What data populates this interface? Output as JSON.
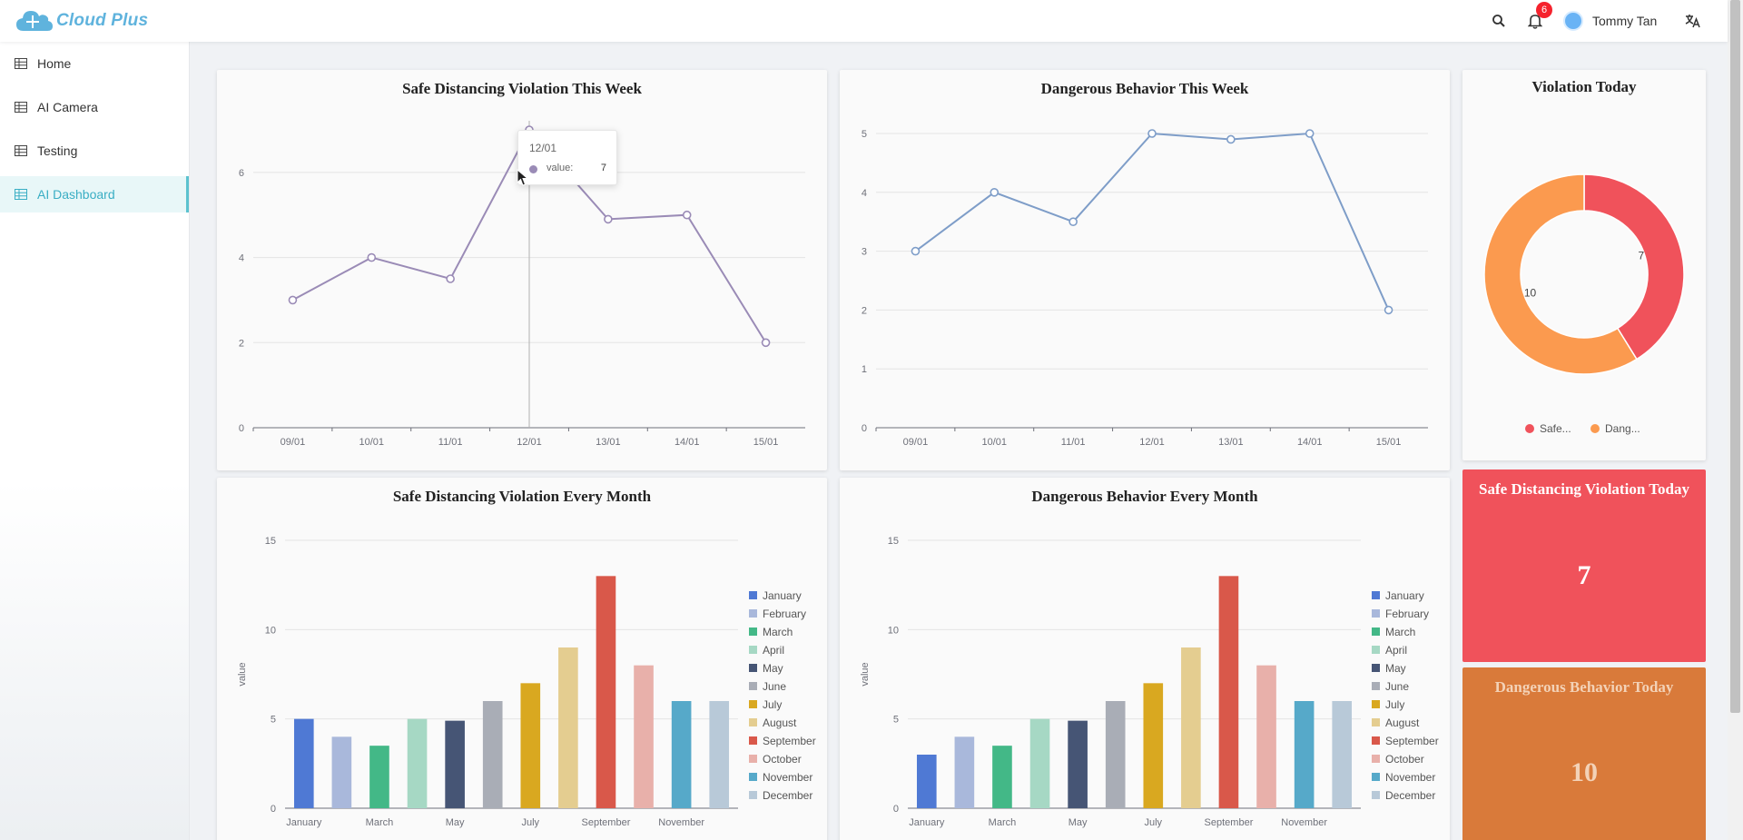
{
  "app": {
    "brand": "Cloud Plus"
  },
  "header": {
    "notification_count": "6",
    "user_name": "Tommy Tan",
    "icons": [
      "search-icon",
      "bell-icon",
      "user-avatar",
      "translate-icon"
    ]
  },
  "sidebar": {
    "items": [
      {
        "label": "Home",
        "icon": "table-icon",
        "active": false
      },
      {
        "label": "AI Camera",
        "icon": "table-icon",
        "active": false
      },
      {
        "label": "Testing",
        "icon": "table-icon",
        "active": false
      },
      {
        "label": "AI Dashboard",
        "icon": "table-icon",
        "active": true
      }
    ]
  },
  "colors": {
    "accent": "#5bc2cf",
    "line_purple": "#9a8bb6",
    "line_blue": "#7e9dc8",
    "safe_red": "#f0525b",
    "danger_orange": "#d97a3a",
    "donut_orange": "#fb9a4f"
  },
  "tooltip": {
    "title": "12/01",
    "label": "value:",
    "value": "7"
  },
  "today": {
    "safe_title": "Safe Distancing Violation Today",
    "safe_value": "7",
    "danger_title": "Dangerous Behavior Today",
    "danger_value": "10"
  },
  "chart_data": [
    {
      "type": "line",
      "title": "Safe Distancing Violation This Week",
      "x": [
        "09/01",
        "10/01",
        "11/01",
        "12/01",
        "13/01",
        "14/01",
        "15/01"
      ],
      "series": [
        {
          "values": [
            3,
            4,
            3.5,
            7,
            4.9,
            5,
            2
          ]
        }
      ],
      "yticks": [
        0,
        2,
        4,
        6
      ],
      "ylim": [
        0,
        7
      ],
      "grid": true
    },
    {
      "type": "line",
      "title": "Dangerous Behavior This Week",
      "x": [
        "09/01",
        "10/01",
        "11/01",
        "12/01",
        "13/01",
        "14/01",
        "15/01"
      ],
      "series": [
        {
          "values": [
            3,
            4,
            3.5,
            5,
            4.9,
            5,
            2
          ]
        }
      ],
      "yticks": [
        0,
        1,
        2,
        3,
        4,
        5
      ],
      "ylim": [
        0,
        5
      ],
      "grid": true
    },
    {
      "type": "pie",
      "title": "Violation Today",
      "slices": [
        {
          "name": "Safe...",
          "value": 7,
          "color": "#f0525b"
        },
        {
          "name": "Dang...",
          "value": 10,
          "color": "#fb9a4f"
        }
      ],
      "legend": "bottom"
    },
    {
      "type": "bar",
      "title": "Safe Distancing Violation Every Month",
      "categories": [
        "January",
        "February",
        "March",
        "April",
        "May",
        "June",
        "July",
        "August",
        "September",
        "October",
        "November",
        "December"
      ],
      "xtick_labels": [
        "January",
        "March",
        "May",
        "July",
        "September",
        "November"
      ],
      "values": [
        5,
        4,
        3.5,
        5,
        4.9,
        6,
        7,
        9,
        13,
        8,
        6,
        6
      ],
      "ylabel": "value",
      "yticks": [
        0,
        5,
        10,
        15
      ],
      "ylim": [
        0,
        15
      ],
      "legend": "right",
      "bar_colors": [
        "#4f79d4",
        "#a9b8db",
        "#43b887",
        "#a6d8c4",
        "#465575",
        "#a9adb6",
        "#d9a820",
        "#e4cd90",
        "#d9584a",
        "#e8b0aa",
        "#56a9c9",
        "#b8c9d8"
      ]
    },
    {
      "type": "bar",
      "title": "Dangerous Behavior Every Month",
      "categories": [
        "January",
        "February",
        "March",
        "April",
        "May",
        "June",
        "July",
        "August",
        "September",
        "October",
        "November",
        "December"
      ],
      "xtick_labels": [
        "January",
        "March",
        "May",
        "July",
        "September",
        "November"
      ],
      "values": [
        3,
        4,
        3.5,
        5,
        4.9,
        6,
        7,
        9,
        13,
        8,
        6,
        6
      ],
      "ylabel": "value",
      "yticks": [
        0,
        5,
        10,
        15
      ],
      "ylim": [
        0,
        15
      ],
      "legend": "right",
      "bar_colors": [
        "#4f79d4",
        "#a9b8db",
        "#43b887",
        "#a6d8c4",
        "#465575",
        "#a9adb6",
        "#d9a820",
        "#e4cd90",
        "#d9584a",
        "#e8b0aa",
        "#56a9c9",
        "#b8c9d8"
      ]
    }
  ]
}
